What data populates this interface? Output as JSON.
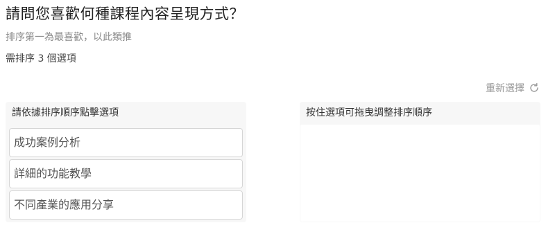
{
  "question": {
    "title": "請問您喜歡何種課程內容呈現方式？",
    "hint": "排序第一為最喜歡，以此類推",
    "requirement": "需排序 3 個選項"
  },
  "reset": {
    "label": "重新選擇",
    "icon": "refresh-icon"
  },
  "left_panel": {
    "header": "請依據排序順序點擊選項",
    "options": [
      "成功案例分析",
      "詳細的功能教學",
      "不同產業的應用分享"
    ]
  },
  "right_panel": {
    "header": "按住選項可拖曳調整排序順序"
  },
  "colors": {
    "panel_bg": "#f7f7f7",
    "option_border": "#d6d6d6",
    "muted_text": "#9a9a9a"
  }
}
